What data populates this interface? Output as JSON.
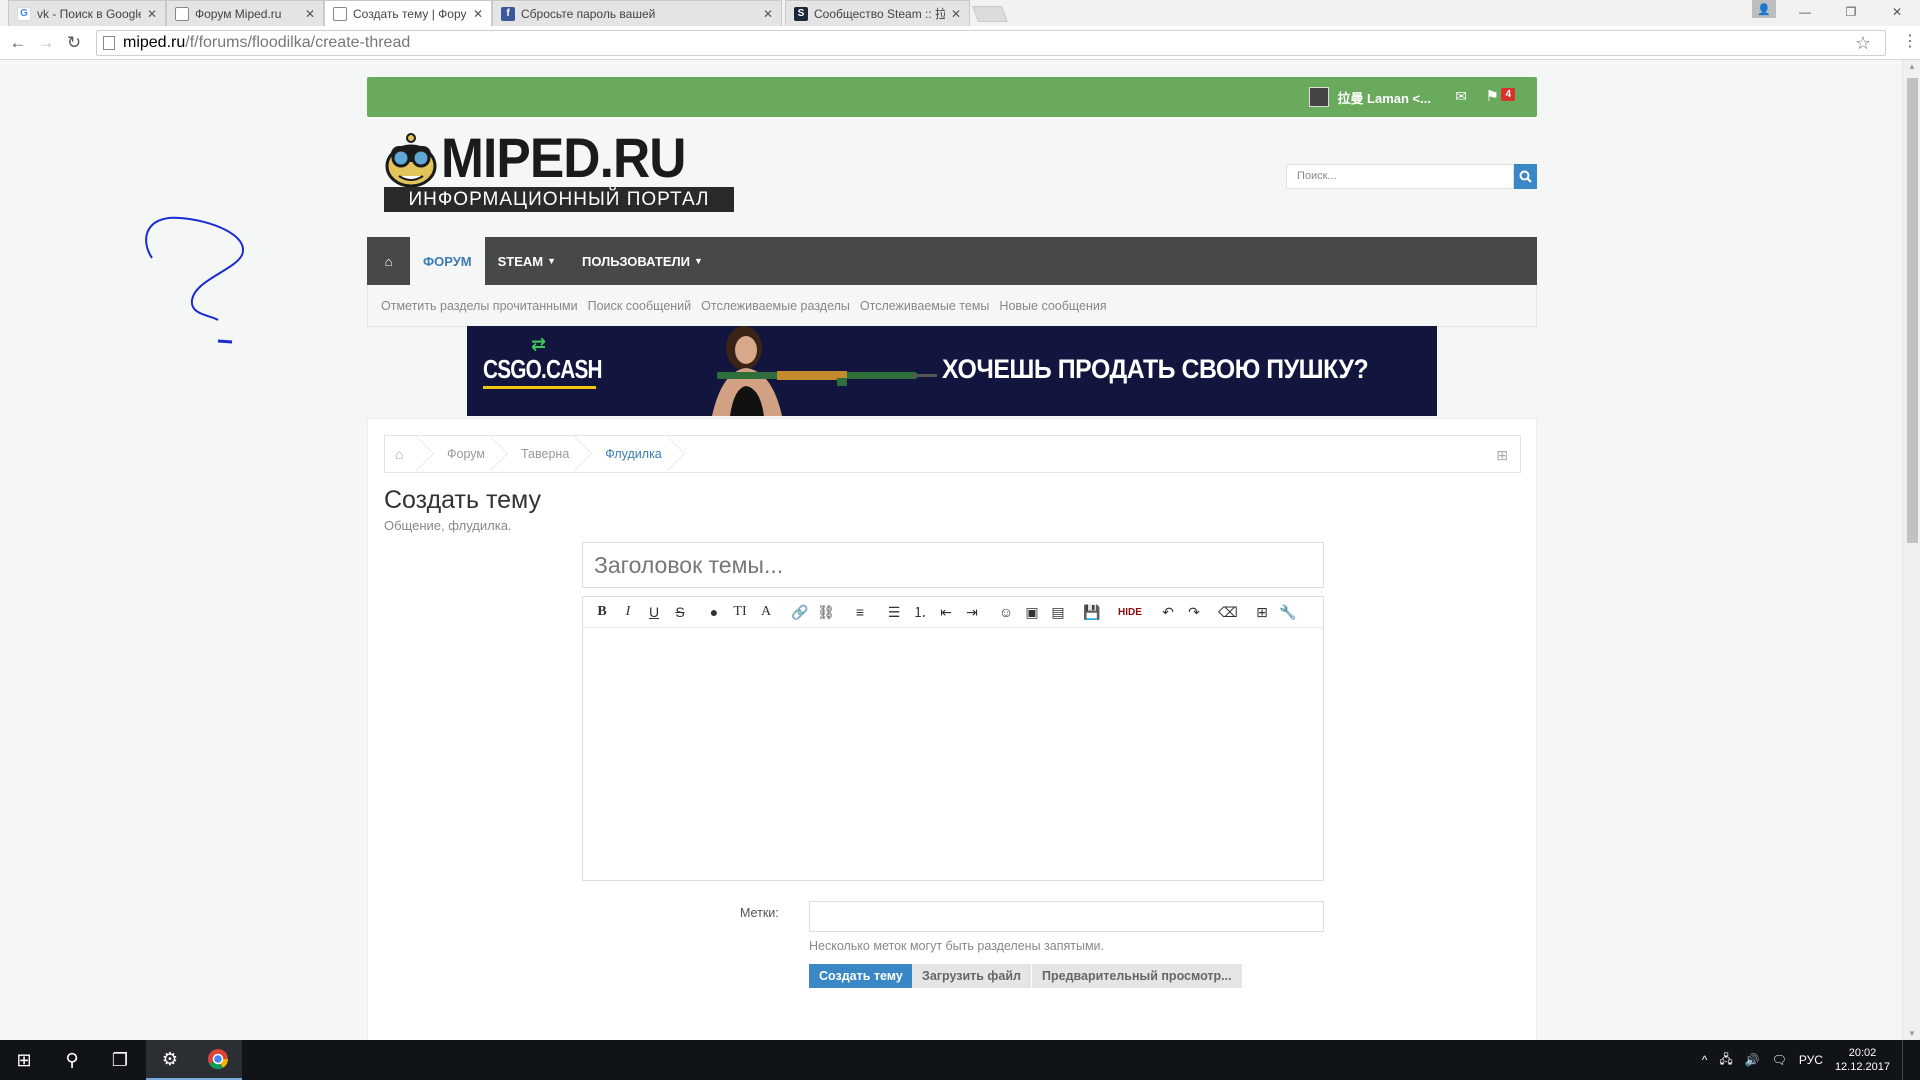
{
  "browser": {
    "tabs": [
      {
        "title": "vk - Поиск в Google",
        "favicon": "google-icon",
        "active": false
      },
      {
        "title": "Форум Miped.ru",
        "favicon": "page-icon",
        "active": false
      },
      {
        "title": "Создать тему | Форум Mi",
        "favicon": "page-icon",
        "active": true
      },
      {
        "title": "Сбросьте пароль вашей",
        "favicon": "facebook-icon",
        "active": false
      },
      {
        "title": "Сообщество Steam :: 拉曼",
        "favicon": "steam-icon",
        "active": false
      }
    ],
    "url_host": "miped.ru",
    "url_path": "/f/forums/floodilka/create-thread"
  },
  "site": {
    "user_name": "拉曼 Laman <...",
    "alert_count": "4",
    "logo_text": "MIPED.RU",
    "logo_subtitle": "ИНФОРМАЦИОННЫЙ ПОРТАЛ",
    "search_placeholder": "Поиск..."
  },
  "nav": {
    "items": [
      {
        "label": "Форум",
        "active": true,
        "dropdown": false
      },
      {
        "label": "Steam",
        "active": false,
        "dropdown": true
      },
      {
        "label": "Пользователи",
        "active": false,
        "dropdown": true
      }
    ],
    "sub_items": [
      "Отметить разделы прочитанными",
      "Поиск сообщений",
      "Отслеживаемые разделы",
      "Отслеживаемые темы",
      "Новые сообщения"
    ]
  },
  "banner": {
    "brand": "CSGO.CASH",
    "text": "ХОЧЕШЬ ПРОДАТЬ СВОЮ ПУШКУ?"
  },
  "breadcrumb": [
    "Форум",
    "Таверна",
    "Флудилка"
  ],
  "page": {
    "title": "Создать тему",
    "description": "Общение, флудилка."
  },
  "form": {
    "title_placeholder": "Заголовок темы...",
    "tags_label": "Метки:",
    "tags_hint": "Несколько меток могут быть разделены запятыми.",
    "create_button": "Создать тему",
    "upload_button": "Загрузить файл",
    "preview_button": "Предварительный просмотр..."
  },
  "editor_toolbar": [
    "bold",
    "italic",
    "underline",
    "strikethrough",
    "text-color",
    "font-size",
    "font-family",
    "link",
    "unlink",
    "align",
    "bullet-list",
    "numbered-list",
    "outdent",
    "indent",
    "smilies",
    "image",
    "media",
    "save-draft",
    "hide",
    "undo",
    "redo",
    "remove-format",
    "insert",
    "tools"
  ],
  "editor_hide_label": "HIDE",
  "taskbar": {
    "language": "РУС",
    "time": "20:02",
    "date": "12.12.2017"
  },
  "colors": {
    "green_bar": "#6aaa5c",
    "nav_bg": "#474949",
    "accent_blue": "#3a87c5",
    "link_blue": "#3a7bb5"
  }
}
